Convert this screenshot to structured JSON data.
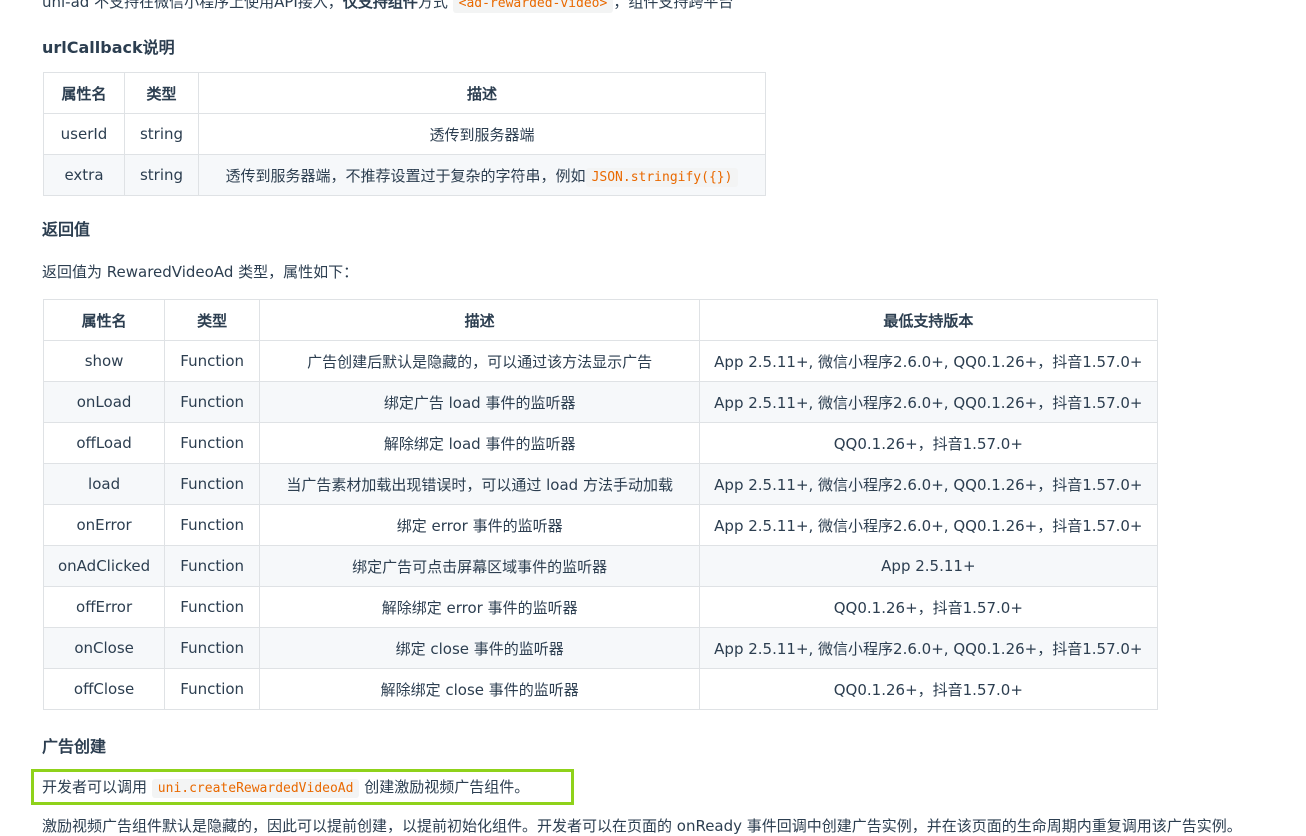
{
  "intro": {
    "text_a": "uni-ad 不支持在微信小程序上使用API接入，",
    "text_b": "仅支持组件",
    "text_c": "方式",
    "code": "<ad-rewarded-video>",
    "text_d": "，组件支持跨平台"
  },
  "url_callback": {
    "heading": "urlCallback说明",
    "headers": [
      "属性名",
      "类型",
      "描述"
    ],
    "rows": [
      {
        "name": "userId",
        "type": "string",
        "desc": "透传到服务器端",
        "code": ""
      },
      {
        "name": "extra",
        "type": "string",
        "desc": "透传到服务器端，不推荐设置过于复杂的字符串，例如",
        "code": "JSON.stringify({})"
      }
    ]
  },
  "return_value": {
    "heading": "返回值",
    "description": "返回值为 RewaredVideoAd 类型，属性如下：",
    "headers": [
      "属性名",
      "类型",
      "描述",
      "最低支持版本"
    ],
    "rows": [
      {
        "name": "show",
        "type": "Function",
        "desc": "广告创建后默认是隐藏的，可以通过该方法显示广告",
        "version": "App 2.5.11+, 微信小程序2.6.0+, QQ0.1.26+，抖音1.57.0+"
      },
      {
        "name": "onLoad",
        "type": "Function",
        "desc": "绑定广告 load 事件的监听器",
        "version": "App 2.5.11+, 微信小程序2.6.0+, QQ0.1.26+，抖音1.57.0+"
      },
      {
        "name": "offLoad",
        "type": "Function",
        "desc": "解除绑定 load 事件的监听器",
        "version": "QQ0.1.26+，抖音1.57.0+"
      },
      {
        "name": "load",
        "type": "Function",
        "desc": "当广告素材加载出现错误时，可以通过 load 方法手动加载",
        "version": "App 2.5.11+, 微信小程序2.6.0+, QQ0.1.26+，抖音1.57.0+"
      },
      {
        "name": "onError",
        "type": "Function",
        "desc": "绑定 error 事件的监听器",
        "version": "App 2.5.11+, 微信小程序2.6.0+, QQ0.1.26+，抖音1.57.0+"
      },
      {
        "name": "onAdClicked",
        "type": "Function",
        "desc": "绑定广告可点击屏幕区域事件的监听器",
        "version": "App 2.5.11+"
      },
      {
        "name": "offError",
        "type": "Function",
        "desc": "解除绑定 error 事件的监听器",
        "version": "QQ0.1.26+，抖音1.57.0+"
      },
      {
        "name": "onClose",
        "type": "Function",
        "desc": "绑定 close 事件的监听器",
        "version": "App 2.5.11+, 微信小程序2.6.0+, QQ0.1.26+，抖音1.57.0+"
      },
      {
        "name": "offClose",
        "type": "Function",
        "desc": "解除绑定 close 事件的监听器",
        "version": "QQ0.1.26+，抖音1.57.0+"
      }
    ]
  },
  "ad_creation": {
    "heading": "广告创建",
    "text_before": "开发者可以调用",
    "code": "uni.createRewardedVideoAd",
    "text_after": "创建激励视频广告组件。",
    "highlight_color": "#8fd21a"
  },
  "bottom_partial": "激励视频广告组件默认是隐藏的，因此可以提前创建，以提前初始化组件。开发者可以在页面的 onReady 事件回调中创建广告实例，并在该页面的生命周期内重复调用该广告实例。"
}
